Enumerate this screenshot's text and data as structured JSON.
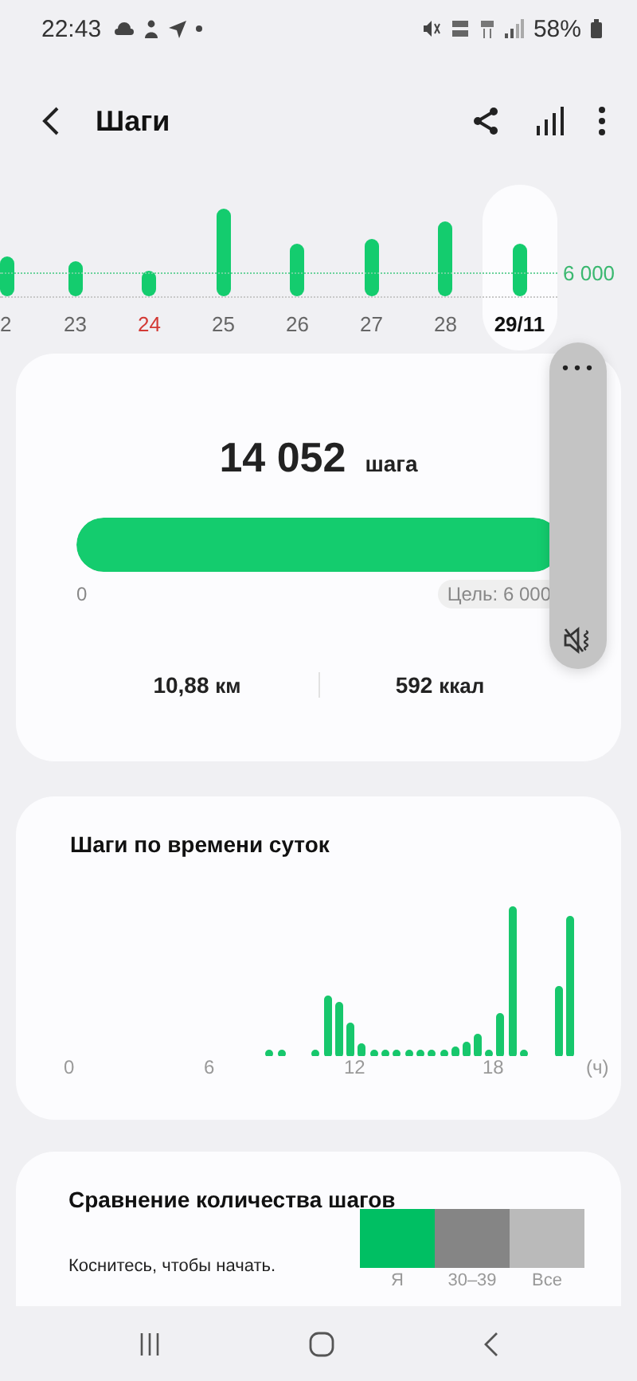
{
  "status_bar": {
    "time": "22:43",
    "battery": "58%"
  },
  "header": {
    "title": "Шаги"
  },
  "week": {
    "goal_label": "6 000",
    "days": [
      {
        "label": "2",
        "selected": false,
        "weekend": false
      },
      {
        "label": "23",
        "selected": false,
        "weekend": false
      },
      {
        "label": "24",
        "selected": false,
        "weekend": true
      },
      {
        "label": "25",
        "selected": false,
        "weekend": false
      },
      {
        "label": "26",
        "selected": false,
        "weekend": false
      },
      {
        "label": "27",
        "selected": false,
        "weekend": false
      },
      {
        "label": "28",
        "selected": false,
        "weekend": false
      },
      {
        "label": "29/11",
        "selected": true,
        "weekend": false
      }
    ]
  },
  "summary": {
    "steps": "14 052",
    "unit": "шага",
    "level": 1.0,
    "min_label": "0",
    "goal": "Цель: 6 000",
    "stats": [
      {
        "value": "10,88",
        "unit": "км"
      },
      {
        "value": "592",
        "unit": "ккал"
      }
    ]
  },
  "volume_panel": {
    "more": "•••"
  },
  "hourly": {
    "title": "Шаги по времени суток",
    "ticks": [
      "0",
      "6",
      "12",
      "18"
    ],
    "unit": "(ч)"
  },
  "comparison": {
    "title": "Сравнение количества шагов",
    "hint": "Коснитесь, чтобы начать.",
    "groups": [
      {
        "label": "Я",
        "color": "#00bf63"
      },
      {
        "label": "30–39",
        "color": "#858585"
      },
      {
        "label": "Все",
        "color": "#bababa"
      }
    ]
  }
}
